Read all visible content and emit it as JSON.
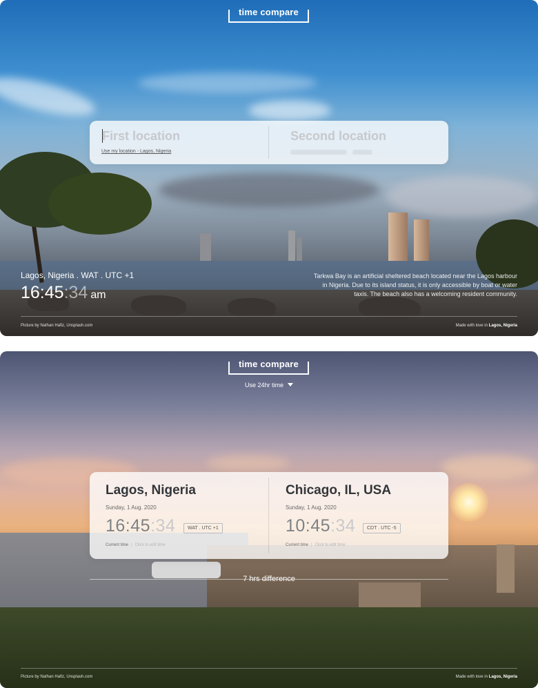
{
  "brand": {
    "title": "time compare"
  },
  "screen1": {
    "search": {
      "first_placeholder": "First location",
      "use_my_location": "Use my location - Lagos, Nigeria",
      "second_placeholder": "Second location"
    },
    "current": {
      "location_line": "Lagos, Nigeria . WAT .  UTC +1",
      "hm": "16:45",
      "sec": ":34",
      "ampm": "am"
    },
    "description": "Tarkwa Bay is an artificial sheltered beach located near the Lagos harbour in Nigeria. Due to its island status, it is only accessible by boat or water taxis. The beach also has a welcoming resident community.",
    "footer": {
      "credit": "Picture by Nathan Hafiz, Unsplash.com",
      "made_prefix": "Made with love in ",
      "made_place": "Lagos, Nigeria"
    }
  },
  "screen2": {
    "format_toggle": "Use 24hr time",
    "locations": [
      {
        "city": "Lagos, Nigeria",
        "date": "Sunday, 1 Aug. 2020",
        "hm": "16:45",
        "sec": ":34",
        "tz": "WAT . UTC +1",
        "current_label": "Current time",
        "edit_label": "Click to edit time"
      },
      {
        "city": "Chicago, IL, USA",
        "date": "Sunday, 1 Aug. 2020",
        "hm": "10:45",
        "sec": ":34",
        "tz": "CDT . UTC -5",
        "current_label": "Current time",
        "edit_label": "Click to edit time"
      }
    ],
    "difference": "7 hrs difference",
    "footer": {
      "credit": "Picture by Nathan Hafiz, Unsplash.com",
      "made_prefix": "Made with love in ",
      "made_place": "Lagos, Nigeria"
    }
  }
}
